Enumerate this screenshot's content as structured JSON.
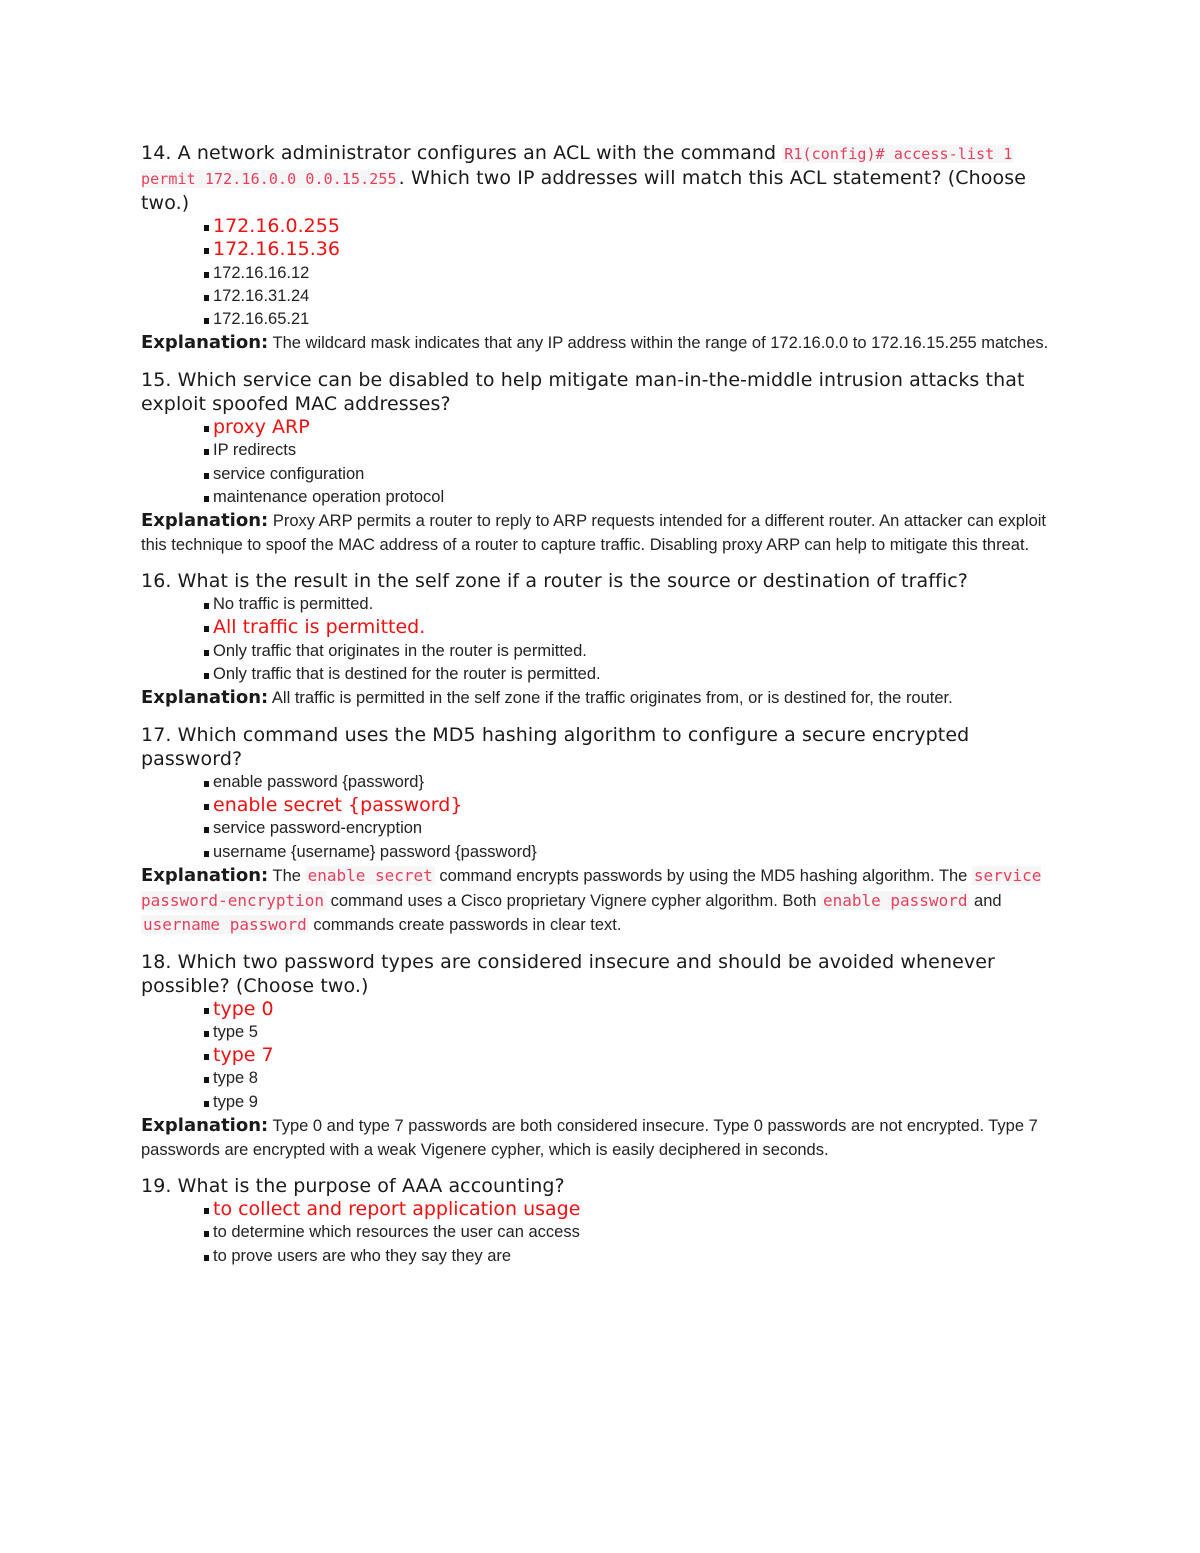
{
  "questions": [
    {
      "number": "14.",
      "text_before": "A network administrator configures an ACL with the command",
      "code": "R1(config)# access-list 1 permit 172.16.0.0 0.0.15.255",
      "text_after": ". Which two IP addresses will match this ACL statement? (Choose two.)",
      "options": [
        {
          "label": "172.16.0.255",
          "correct": true
        },
        {
          "label": "172.16.15.36",
          "correct": true
        },
        {
          "label": "172.16.16.12",
          "correct": false
        },
        {
          "label": "172.16.31.24",
          "correct": false
        },
        {
          "label": "172.16.65.21",
          "correct": false
        }
      ],
      "explanation_label": "Explanation:",
      "explanation": "The wildcard mask indicates that any IP address within the range of 172.16.0.0 to 172.16.15.255 matches."
    },
    {
      "number": "15.",
      "text": "Which service can be disabled to help mitigate man-in-the-middle intrusion attacks that exploit spoofed MAC addresses?",
      "options": [
        {
          "label": "proxy ARP",
          "correct": true
        },
        {
          "label": "IP redirects",
          "correct": false
        },
        {
          "label": "service configuration",
          "correct": false
        },
        {
          "label": "maintenance operation protocol",
          "correct": false
        }
      ],
      "explanation_label": "Explanation:",
      "explanation": "Proxy ARP permits a router to reply to ARP requests intended for a different router. An attacker can exploit this technique to spoof the MAC address of a router to capture traffic. Disabling proxy ARP can help to mitigate this threat."
    },
    {
      "number": "16.",
      "text": "What is the result in the self zone if a router is the source or destination of traffic?",
      "options": [
        {
          "label": "No traffic is permitted.",
          "correct": false
        },
        {
          "label": "All traffic is permitted.",
          "correct": true
        },
        {
          "label": "Only traffic that originates in the router is permitted.",
          "correct": false
        },
        {
          "label": "Only traffic that is destined for the router is permitted.",
          "correct": false
        }
      ],
      "explanation_label": "Explanation:",
      "explanation": "All traffic is permitted in the self zone if the traffic originates from, or is destined for, the router."
    },
    {
      "number": "17.",
      "text": "Which command uses the MD5 hashing algorithm to configure a secure encrypted password?",
      "options": [
        {
          "label": "enable password {password}",
          "correct": false
        },
        {
          "label": "enable secret {password}",
          "correct": true
        },
        {
          "label": "service password-encryption",
          "correct": false
        },
        {
          "label": "username {username} password {password}",
          "correct": false
        }
      ],
      "explanation_label": "Explanation:",
      "explanation_parts": [
        {
          "t": "The "
        },
        {
          "c": "enable secret"
        },
        {
          "t": " command encrypts passwords by using the MD5 hashing algorithm. The "
        },
        {
          "c": "service password-encryption"
        },
        {
          "t": " command uses a Cisco proprietary Vignere cypher algorithm. Both "
        },
        {
          "c": "enable password"
        },
        {
          "t": " and "
        },
        {
          "c": "username password"
        },
        {
          "t": " commands create passwords in clear text."
        }
      ]
    },
    {
      "number": "18.",
      "text": "Which two password types are considered insecure and should be avoided whenever possible? (Choose two.)",
      "options": [
        {
          "label": "type 0",
          "correct": true
        },
        {
          "label": "type 5",
          "correct": false
        },
        {
          "label": "type 7",
          "correct": true
        },
        {
          "label": "type 8",
          "correct": false
        },
        {
          "label": "type 9",
          "correct": false
        }
      ],
      "explanation_label": "Explanation:",
      "explanation": "Type 0 and type 7 passwords are both considered insecure. Type 0 passwords are not encrypted. Type 7 passwords are encrypted with a weak Vigenere cypher, which is easily deciphered in seconds."
    },
    {
      "number": "19.",
      "text": "What is the purpose of AAA accounting?",
      "options": [
        {
          "label": "to collect and report application usage",
          "correct": true
        },
        {
          "label": "to determine which resources the user can access",
          "correct": false
        },
        {
          "label": "to prove users are who they say they are",
          "correct": false
        }
      ]
    }
  ],
  "colors": {
    "correct_answer": "#ee1111",
    "code_text": "#e83e5c",
    "code_background": "#f6f6f6"
  }
}
